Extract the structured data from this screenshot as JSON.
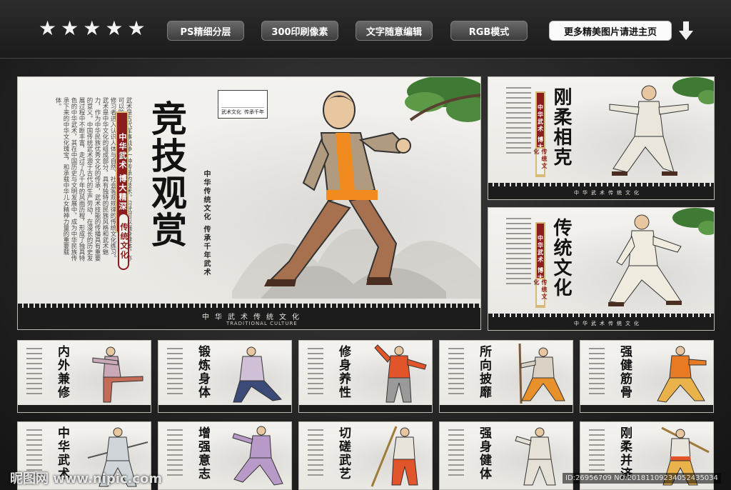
{
  "toolbar": {
    "stars": [
      "★",
      "★",
      "★",
      "★",
      "★"
    ],
    "badges": [
      "PS精细分层",
      "300印刷像素",
      "文字随意编辑",
      "RGB模式"
    ],
    "more_link": "更多精美图片请进主页",
    "accent": "#8b1d1f"
  },
  "main_panel": {
    "title": "竞技观赏",
    "red_column": "中华武术 博大精深",
    "seal_text": "传统文化",
    "side_caption": "中华传统文化 传承千年武术",
    "stamp_labels": [
      "武术文化",
      "传承千年"
    ],
    "body_text": "武术是古代军事战争一种传承的技术。习武可以强身健体，亦可以防御敌人进攻。习武之人以“制止侵袭”为技术导向，引领修习者进入认识人体与自然、社会客观规律的传统文化练习。武术是中华文化的组成部分，具有独特的民族风格和武术魅力，作为中华民族优秀文化的传承，武术技能的传播具有重要的意义。中国传统武术源于古代的生产劳动，在漫长的历史发展过程中不断丰富，走过了几千年的风雨历程，形成了独具特色的中华武术，其在中国历史与文明发展中，成为中华民族传承下来的中华文化瑰宝，和承载中华儿女精神力量的重要载体。",
    "band_label": "中华武术传统文化",
    "band_sub": "TRADITIONAL CULTURE"
  },
  "side_panels": [
    {
      "title": "刚柔相克",
      "red_column": "中华武术 博大精深",
      "seal_text": "传统文化",
      "band_label": "中华武术传统文化"
    },
    {
      "title": "传统文化",
      "red_column": "中华武术 博大精深",
      "seal_text": "传统文化",
      "band_label": "中华武术传统文化"
    }
  ],
  "small_panels_row1": [
    {
      "title": "内外兼修"
    },
    {
      "title": "锻炼身体"
    },
    {
      "title": "修身养性"
    },
    {
      "title": "所向披靡"
    },
    {
      "title": "强健筋骨"
    }
  ],
  "small_panels_row2": [
    {
      "title": "中华武术"
    },
    {
      "title": "增强意志"
    },
    {
      "title": "切磋武艺"
    },
    {
      "title": "强身健体"
    },
    {
      "title": "刚柔并济"
    }
  ],
  "watermark": {
    "left": "昵图网 www.nipic.com",
    "right": "ID:26956709 NO:20181109234052435034"
  }
}
